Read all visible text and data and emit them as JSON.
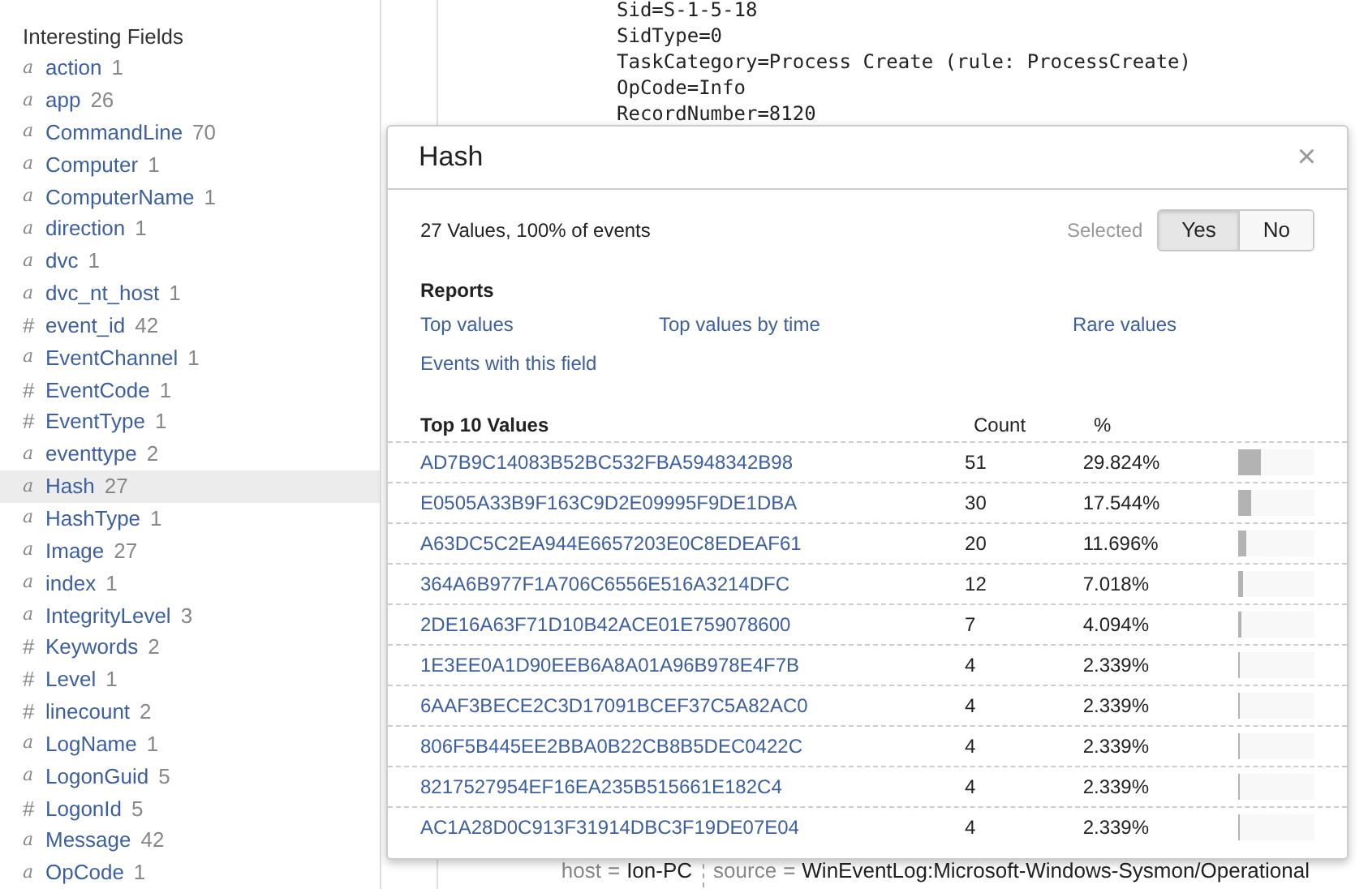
{
  "sidebar": {
    "title": "Interesting Fields",
    "fields": [
      {
        "kind": "string",
        "type_mark": "a",
        "name": "action",
        "count": "1",
        "selected": false
      },
      {
        "kind": "string",
        "type_mark": "a",
        "name": "app",
        "count": "26",
        "selected": false
      },
      {
        "kind": "string",
        "type_mark": "a",
        "name": "CommandLine",
        "count": "70",
        "selected": false
      },
      {
        "kind": "string",
        "type_mark": "a",
        "name": "Computer",
        "count": "1",
        "selected": false
      },
      {
        "kind": "string",
        "type_mark": "a",
        "name": "ComputerName",
        "count": "1",
        "selected": false
      },
      {
        "kind": "string",
        "type_mark": "a",
        "name": "direction",
        "count": "1",
        "selected": false
      },
      {
        "kind": "string",
        "type_mark": "a",
        "name": "dvc",
        "count": "1",
        "selected": false
      },
      {
        "kind": "string",
        "type_mark": "a",
        "name": "dvc_nt_host",
        "count": "1",
        "selected": false
      },
      {
        "kind": "number",
        "type_mark": "#",
        "name": "event_id",
        "count": "42",
        "selected": false
      },
      {
        "kind": "string",
        "type_mark": "a",
        "name": "EventChannel",
        "count": "1",
        "selected": false
      },
      {
        "kind": "number",
        "type_mark": "#",
        "name": "EventCode",
        "count": "1",
        "selected": false
      },
      {
        "kind": "number",
        "type_mark": "#",
        "name": "EventType",
        "count": "1",
        "selected": false
      },
      {
        "kind": "string",
        "type_mark": "a",
        "name": "eventtype",
        "count": "2",
        "selected": false
      },
      {
        "kind": "string",
        "type_mark": "a",
        "name": "Hash",
        "count": "27",
        "selected": true
      },
      {
        "kind": "string",
        "type_mark": "a",
        "name": "HashType",
        "count": "1",
        "selected": false
      },
      {
        "kind": "string",
        "type_mark": "a",
        "name": "Image",
        "count": "27",
        "selected": false
      },
      {
        "kind": "string",
        "type_mark": "a",
        "name": "index",
        "count": "1",
        "selected": false
      },
      {
        "kind": "string",
        "type_mark": "a",
        "name": "IntegrityLevel",
        "count": "3",
        "selected": false
      },
      {
        "kind": "number",
        "type_mark": "#",
        "name": "Keywords",
        "count": "2",
        "selected": false
      },
      {
        "kind": "number",
        "type_mark": "#",
        "name": "Level",
        "count": "1",
        "selected": false
      },
      {
        "kind": "number",
        "type_mark": "#",
        "name": "linecount",
        "count": "2",
        "selected": false
      },
      {
        "kind": "string",
        "type_mark": "a",
        "name": "LogName",
        "count": "1",
        "selected": false
      },
      {
        "kind": "string",
        "type_mark": "a",
        "name": "LogonGuid",
        "count": "5",
        "selected": false
      },
      {
        "kind": "number",
        "type_mark": "#",
        "name": "LogonId",
        "count": "5",
        "selected": false
      },
      {
        "kind": "string",
        "type_mark": "a",
        "name": "Message",
        "count": "42",
        "selected": false
      },
      {
        "kind": "string",
        "type_mark": "a",
        "name": "OpCode",
        "count": "1",
        "selected": false
      }
    ]
  },
  "event": {
    "lines": [
      "Sid=S-1-5-18",
      "SidType=0",
      "TaskCategory=Process Create (rule: ProcessCreate)",
      "OpCode=Info",
      "RecordNumber=8120"
    ],
    "footer": [
      {
        "key": "host",
        "separator": "=",
        "value": "Ion-PC"
      },
      {
        "key": "source",
        "separator": "=",
        "value": "WinEventLog:Microsoft-Windows-Sysmon/Operational"
      }
    ]
  },
  "popup": {
    "title": "Hash",
    "close": "×",
    "summary": "27 Values, 100% of events",
    "selected_label": "Selected",
    "selected_options": [
      {
        "label": "Yes",
        "selected": true
      },
      {
        "label": "No",
        "selected": false
      }
    ],
    "reports_title": "Reports",
    "reports": [
      "Top values",
      "Top values by time",
      "Rare values",
      "Events with this field"
    ],
    "table": {
      "columns": [
        "Top 10 Values",
        "Count",
        "%"
      ],
      "rows": [
        {
          "value": "AD7B9C14083B52BC532FBA5948342B98",
          "count": "51",
          "percent": "29.824%",
          "level": 0.298
        },
        {
          "value": "E0505A33B9F163C9D2E09995F9DE1DBA",
          "count": "30",
          "percent": "17.544%",
          "level": 0.175
        },
        {
          "value": "A63DC5C2EA944E6657203E0C8EDEAF61",
          "count": "20",
          "percent": "11.696%",
          "level": 0.117
        },
        {
          "value": "364A6B977F1A706C6556E516A3214DFC",
          "count": "12",
          "percent": "7.018%",
          "level": 0.07
        },
        {
          "value": "2DE16A63F71D10B42ACE01E759078600",
          "count": "7",
          "percent": "4.094%",
          "level": 0.041
        },
        {
          "value": "1E3EE0A1D90EEB6A8A01A96B978E4F7B",
          "count": "4",
          "percent": "2.339%",
          "level": 0.023
        },
        {
          "value": "6AAF3BECE2C3D17091BCEF37C5A82AC0",
          "count": "4",
          "percent": "2.339%",
          "level": 0.023
        },
        {
          "value": "806F5B445EE2BBA0B22CB8B5DEC0422C",
          "count": "4",
          "percent": "2.339%",
          "level": 0.023
        },
        {
          "value": "8217527954EF16EA235B515661E182C4",
          "count": "4",
          "percent": "2.339%",
          "level": 0.023
        },
        {
          "value": "AC1A28D0C913F31914DBC3F19DE07E04",
          "count": "4",
          "percent": "2.339%",
          "level": 0.023
        }
      ]
    }
  }
}
